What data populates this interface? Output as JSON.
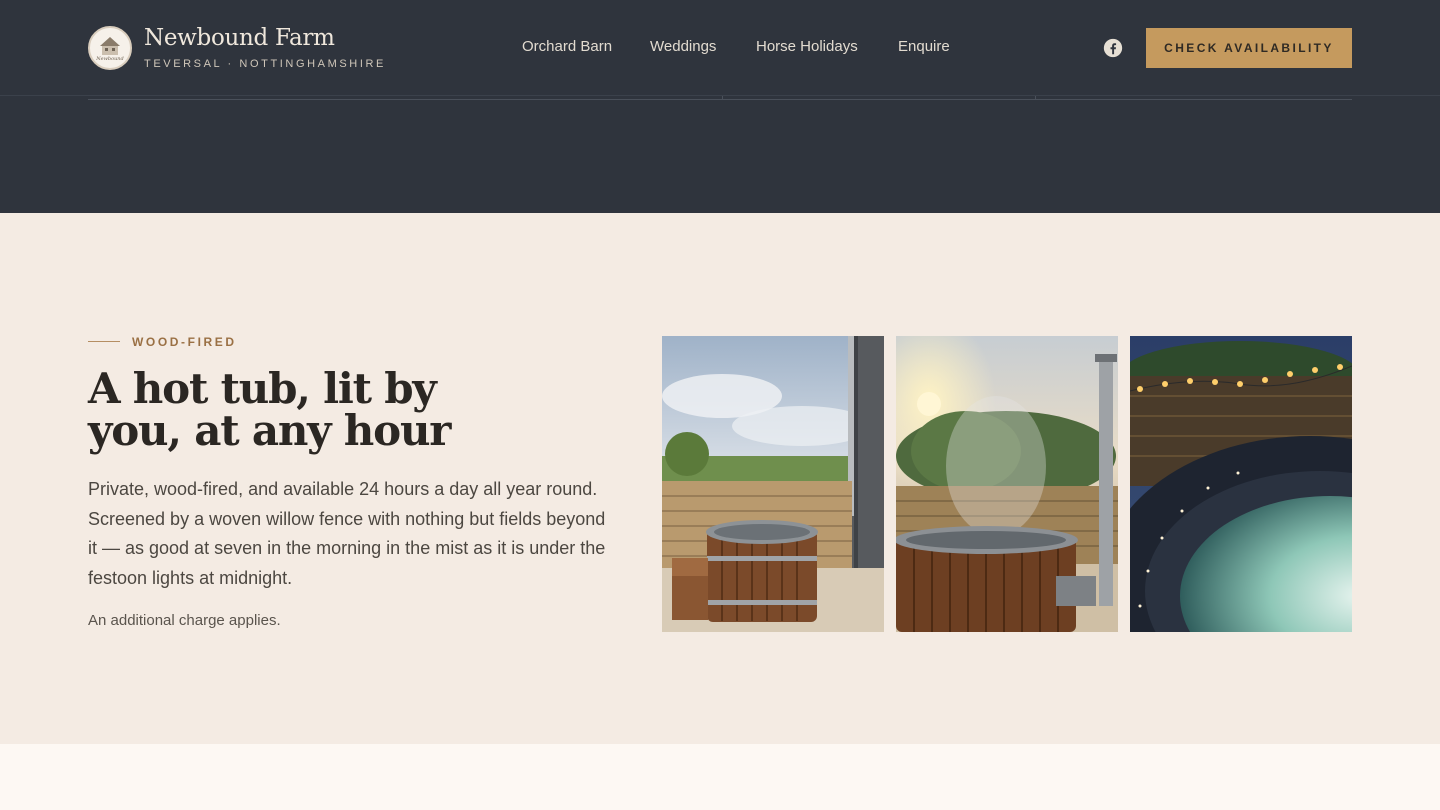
{
  "header": {
    "brand_name": "Newbound Farm",
    "brand_sub": "TEVERSAL · NOTTINGHAMSHIRE",
    "logo_text": "Newbound",
    "nav": [
      "Orchard Barn",
      "Weddings",
      "Horse Holidays",
      "Enquire"
    ],
    "social_icon": "facebook-icon",
    "cta_label": "CHECK AVAILABILITY"
  },
  "section": {
    "eyebrow": "WOOD-FIRED",
    "headline_line1": "A hot tub, lit by",
    "headline_line2": "you, at any hour",
    "body": "Private, wood-fired, and available 24 hours a day all year round. Screened by a woven willow fence with nothing but fields beyond it — as good at seven in the morning in the mist as it is under the festoon lights at midnight.",
    "note": "An additional charge applies.",
    "photos": [
      "hot-tub-daytime-photo",
      "hot-tub-sunrise-steam-photo",
      "hot-tub-night-festoon-photo"
    ]
  },
  "colors": {
    "dark": "#2f343d",
    "cream": "#f4ebe3",
    "accent": "#c59a5e",
    "eyebrow": "#9a7044"
  }
}
